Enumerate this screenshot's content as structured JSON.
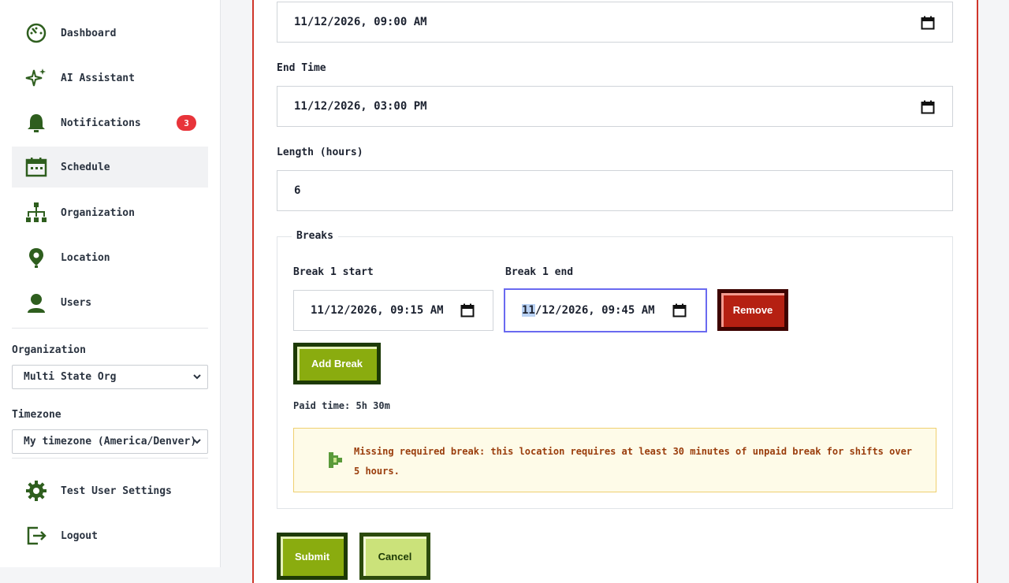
{
  "sidebar": {
    "items": [
      {
        "label": "Dashboard",
        "icon": "dashboard-icon"
      },
      {
        "label": "AI Assistant",
        "icon": "sparkle-icon"
      },
      {
        "label": "Notifications",
        "icon": "bell-icon",
        "badge": "3"
      },
      {
        "label": "Schedule",
        "icon": "calendar-icon",
        "active": true
      },
      {
        "label": "Organization",
        "icon": "org-chart-icon"
      },
      {
        "label": "Location",
        "icon": "map-pin-icon"
      },
      {
        "label": "Users",
        "icon": "user-icon"
      }
    ],
    "organization": {
      "label": "Organization",
      "value": "Multi State Org"
    },
    "timezone": {
      "label": "Timezone",
      "value": "My timezone (America/Denver)"
    },
    "settings": {
      "label": "Test User Settings",
      "icon": "gear-icon"
    },
    "logout": {
      "label": "Logout",
      "icon": "logout-icon"
    }
  },
  "form": {
    "start_time": {
      "value": "11/12/2026, 09:00 AM"
    },
    "end_time": {
      "label": "End Time",
      "value": "11/12/2026, 03:00 PM"
    },
    "length": {
      "label": "Length (hours)",
      "value": "6"
    },
    "breaks": {
      "legend": "Breaks",
      "break1_start_label": "Break 1 start",
      "break1_start_value": "11/12/2026, 09:15 AM",
      "break1_end_label": "Break 1 end",
      "break1_end_value_selected": "11",
      "break1_end_value_rest": "/12/2026, 09:45 AM",
      "remove_label": "Remove",
      "add_label": "Add Break",
      "paid_time": "Paid time: 5h 30m",
      "warning": "Missing required break: this location requires at least 30 minutes of unpaid break for shifts over 5 hours."
    },
    "submit_label": "Submit",
    "cancel_label": "Cancel"
  },
  "colors": {
    "accent_green": "#8aac0f",
    "danger_red": "#b52012",
    "panel_border": "#d0362b",
    "badge_red": "#e8343a",
    "icon_green": "#2e5e1e"
  }
}
